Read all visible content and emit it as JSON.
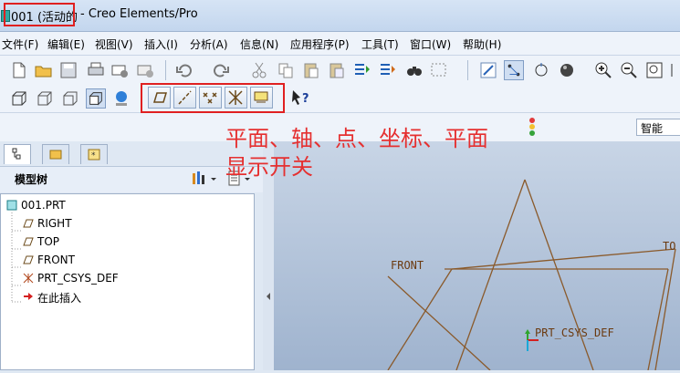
{
  "window": {
    "document_title": "001 (活动的",
    "app_title": "- Creo Elements/Pro"
  },
  "menu": {
    "items": [
      {
        "label": "文件(F)"
      },
      {
        "label": "编辑(E)"
      },
      {
        "label": "视图(V)"
      },
      {
        "label": "插入(I)"
      },
      {
        "label": "分析(A)"
      },
      {
        "label": "信息(N)"
      },
      {
        "label": "应用程序(P)"
      },
      {
        "label": "工具(T)"
      },
      {
        "label": "窗口(W)"
      },
      {
        "label": "帮助(H)"
      }
    ]
  },
  "filter": {
    "selected": "智能"
  },
  "annotation": {
    "line1": "平面、轴、点、坐标、平面",
    "line2": "显示开关"
  },
  "model_tree": {
    "title": "模型树",
    "items": [
      {
        "label": "001.PRT",
        "icon": "part-icon"
      },
      {
        "label": "RIGHT",
        "icon": "datum-plane-icon"
      },
      {
        "label": "TOP",
        "icon": "datum-plane-icon"
      },
      {
        "label": "FRONT",
        "icon": "datum-plane-icon"
      },
      {
        "label": "PRT_CSYS_DEF",
        "icon": "csys-icon"
      },
      {
        "label": "在此插入",
        "icon": "insert-arrow-icon"
      }
    ]
  },
  "viewport": {
    "labels": {
      "front": "FRONT",
      "top": "TO",
      "csys": "PRT_CSYS_DEF"
    }
  },
  "colors": {
    "annotation": "#e53030",
    "highlight_box": "#e02020",
    "datum_lines": "#8a5a2b"
  }
}
